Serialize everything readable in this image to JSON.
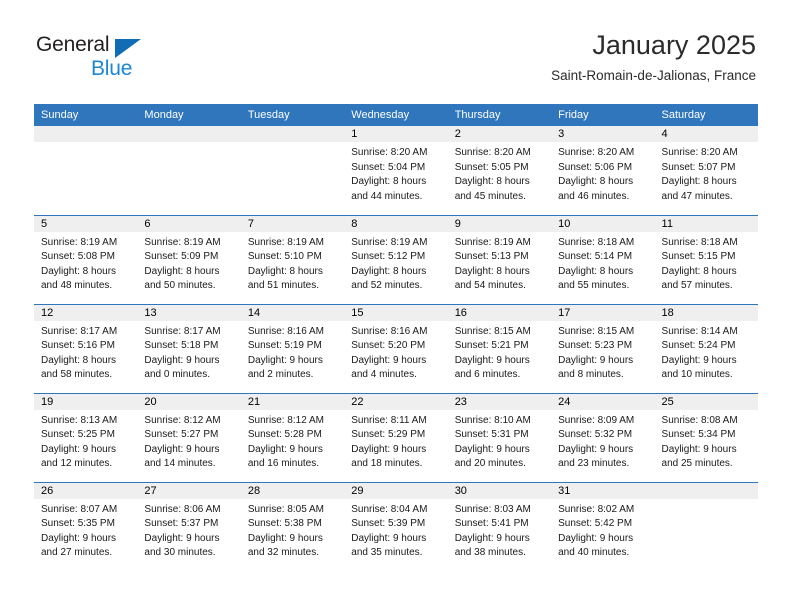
{
  "branding": {
    "logo_text_primary": "General",
    "logo_text_secondary": "Blue",
    "primary_color": "#231f20",
    "secondary_color": "#1b87d6",
    "triangle_color": "#0f6cb5"
  },
  "header": {
    "month_title": "January 2025",
    "location": "Saint-Romain-de-Jalionas, France"
  },
  "theme": {
    "header_bg": "#2f76bc",
    "header_text": "#ffffff",
    "date_band_bg": "#efefef",
    "row_divider": "#2f76bc"
  },
  "calendar": {
    "weekday_headers": [
      "Sunday",
      "Monday",
      "Tuesday",
      "Wednesday",
      "Thursday",
      "Friday",
      "Saturday"
    ],
    "weeks": [
      [
        {
          "date": "",
          "empty": true,
          "sunrise": "",
          "sunset": "",
          "daylight_line1": "",
          "daylight_line2": ""
        },
        {
          "date": "",
          "empty": true,
          "sunrise": "",
          "sunset": "",
          "daylight_line1": "",
          "daylight_line2": ""
        },
        {
          "date": "",
          "empty": true,
          "sunrise": "",
          "sunset": "",
          "daylight_line1": "",
          "daylight_line2": ""
        },
        {
          "date": "1",
          "empty": false,
          "sunrise": "Sunrise: 8:20 AM",
          "sunset": "Sunset: 5:04 PM",
          "daylight_line1": "Daylight: 8 hours",
          "daylight_line2": "and 44 minutes."
        },
        {
          "date": "2",
          "empty": false,
          "sunrise": "Sunrise: 8:20 AM",
          "sunset": "Sunset: 5:05 PM",
          "daylight_line1": "Daylight: 8 hours",
          "daylight_line2": "and 45 minutes."
        },
        {
          "date": "3",
          "empty": false,
          "sunrise": "Sunrise: 8:20 AM",
          "sunset": "Sunset: 5:06 PM",
          "daylight_line1": "Daylight: 8 hours",
          "daylight_line2": "and 46 minutes."
        },
        {
          "date": "4",
          "empty": false,
          "sunrise": "Sunrise: 8:20 AM",
          "sunset": "Sunset: 5:07 PM",
          "daylight_line1": "Daylight: 8 hours",
          "daylight_line2": "and 47 minutes."
        }
      ],
      [
        {
          "date": "5",
          "empty": false,
          "sunrise": "Sunrise: 8:19 AM",
          "sunset": "Sunset: 5:08 PM",
          "daylight_line1": "Daylight: 8 hours",
          "daylight_line2": "and 48 minutes."
        },
        {
          "date": "6",
          "empty": false,
          "sunrise": "Sunrise: 8:19 AM",
          "sunset": "Sunset: 5:09 PM",
          "daylight_line1": "Daylight: 8 hours",
          "daylight_line2": "and 50 minutes."
        },
        {
          "date": "7",
          "empty": false,
          "sunrise": "Sunrise: 8:19 AM",
          "sunset": "Sunset: 5:10 PM",
          "daylight_line1": "Daylight: 8 hours",
          "daylight_line2": "and 51 minutes."
        },
        {
          "date": "8",
          "empty": false,
          "sunrise": "Sunrise: 8:19 AM",
          "sunset": "Sunset: 5:12 PM",
          "daylight_line1": "Daylight: 8 hours",
          "daylight_line2": "and 52 minutes."
        },
        {
          "date": "9",
          "empty": false,
          "sunrise": "Sunrise: 8:19 AM",
          "sunset": "Sunset: 5:13 PM",
          "daylight_line1": "Daylight: 8 hours",
          "daylight_line2": "and 54 minutes."
        },
        {
          "date": "10",
          "empty": false,
          "sunrise": "Sunrise: 8:18 AM",
          "sunset": "Sunset: 5:14 PM",
          "daylight_line1": "Daylight: 8 hours",
          "daylight_line2": "and 55 minutes."
        },
        {
          "date": "11",
          "empty": false,
          "sunrise": "Sunrise: 8:18 AM",
          "sunset": "Sunset: 5:15 PM",
          "daylight_line1": "Daylight: 8 hours",
          "daylight_line2": "and 57 minutes."
        }
      ],
      [
        {
          "date": "12",
          "empty": false,
          "sunrise": "Sunrise: 8:17 AM",
          "sunset": "Sunset: 5:16 PM",
          "daylight_line1": "Daylight: 8 hours",
          "daylight_line2": "and 58 minutes."
        },
        {
          "date": "13",
          "empty": false,
          "sunrise": "Sunrise: 8:17 AM",
          "sunset": "Sunset: 5:18 PM",
          "daylight_line1": "Daylight: 9 hours",
          "daylight_line2": "and 0 minutes."
        },
        {
          "date": "14",
          "empty": false,
          "sunrise": "Sunrise: 8:16 AM",
          "sunset": "Sunset: 5:19 PM",
          "daylight_line1": "Daylight: 9 hours",
          "daylight_line2": "and 2 minutes."
        },
        {
          "date": "15",
          "empty": false,
          "sunrise": "Sunrise: 8:16 AM",
          "sunset": "Sunset: 5:20 PM",
          "daylight_line1": "Daylight: 9 hours",
          "daylight_line2": "and 4 minutes."
        },
        {
          "date": "16",
          "empty": false,
          "sunrise": "Sunrise: 8:15 AM",
          "sunset": "Sunset: 5:21 PM",
          "daylight_line1": "Daylight: 9 hours",
          "daylight_line2": "and 6 minutes."
        },
        {
          "date": "17",
          "empty": false,
          "sunrise": "Sunrise: 8:15 AM",
          "sunset": "Sunset: 5:23 PM",
          "daylight_line1": "Daylight: 9 hours",
          "daylight_line2": "and 8 minutes."
        },
        {
          "date": "18",
          "empty": false,
          "sunrise": "Sunrise: 8:14 AM",
          "sunset": "Sunset: 5:24 PM",
          "daylight_line1": "Daylight: 9 hours",
          "daylight_line2": "and 10 minutes."
        }
      ],
      [
        {
          "date": "19",
          "empty": false,
          "sunrise": "Sunrise: 8:13 AM",
          "sunset": "Sunset: 5:25 PM",
          "daylight_line1": "Daylight: 9 hours",
          "daylight_line2": "and 12 minutes."
        },
        {
          "date": "20",
          "empty": false,
          "sunrise": "Sunrise: 8:12 AM",
          "sunset": "Sunset: 5:27 PM",
          "daylight_line1": "Daylight: 9 hours",
          "daylight_line2": "and 14 minutes."
        },
        {
          "date": "21",
          "empty": false,
          "sunrise": "Sunrise: 8:12 AM",
          "sunset": "Sunset: 5:28 PM",
          "daylight_line1": "Daylight: 9 hours",
          "daylight_line2": "and 16 minutes."
        },
        {
          "date": "22",
          "empty": false,
          "sunrise": "Sunrise: 8:11 AM",
          "sunset": "Sunset: 5:29 PM",
          "daylight_line1": "Daylight: 9 hours",
          "daylight_line2": "and 18 minutes."
        },
        {
          "date": "23",
          "empty": false,
          "sunrise": "Sunrise: 8:10 AM",
          "sunset": "Sunset: 5:31 PM",
          "daylight_line1": "Daylight: 9 hours",
          "daylight_line2": "and 20 minutes."
        },
        {
          "date": "24",
          "empty": false,
          "sunrise": "Sunrise: 8:09 AM",
          "sunset": "Sunset: 5:32 PM",
          "daylight_line1": "Daylight: 9 hours",
          "daylight_line2": "and 23 minutes."
        },
        {
          "date": "25",
          "empty": false,
          "sunrise": "Sunrise: 8:08 AM",
          "sunset": "Sunset: 5:34 PM",
          "daylight_line1": "Daylight: 9 hours",
          "daylight_line2": "and 25 minutes."
        }
      ],
      [
        {
          "date": "26",
          "empty": false,
          "sunrise": "Sunrise: 8:07 AM",
          "sunset": "Sunset: 5:35 PM",
          "daylight_line1": "Daylight: 9 hours",
          "daylight_line2": "and 27 minutes."
        },
        {
          "date": "27",
          "empty": false,
          "sunrise": "Sunrise: 8:06 AM",
          "sunset": "Sunset: 5:37 PM",
          "daylight_line1": "Daylight: 9 hours",
          "daylight_line2": "and 30 minutes."
        },
        {
          "date": "28",
          "empty": false,
          "sunrise": "Sunrise: 8:05 AM",
          "sunset": "Sunset: 5:38 PM",
          "daylight_line1": "Daylight: 9 hours",
          "daylight_line2": "and 32 minutes."
        },
        {
          "date": "29",
          "empty": false,
          "sunrise": "Sunrise: 8:04 AM",
          "sunset": "Sunset: 5:39 PM",
          "daylight_line1": "Daylight: 9 hours",
          "daylight_line2": "and 35 minutes."
        },
        {
          "date": "30",
          "empty": false,
          "sunrise": "Sunrise: 8:03 AM",
          "sunset": "Sunset: 5:41 PM",
          "daylight_line1": "Daylight: 9 hours",
          "daylight_line2": "and 38 minutes."
        },
        {
          "date": "31",
          "empty": false,
          "sunrise": "Sunrise: 8:02 AM",
          "sunset": "Sunset: 5:42 PM",
          "daylight_line1": "Daylight: 9 hours",
          "daylight_line2": "and 40 minutes."
        },
        {
          "date": "",
          "empty": true,
          "sunrise": "",
          "sunset": "",
          "daylight_line1": "",
          "daylight_line2": ""
        }
      ]
    ]
  }
}
